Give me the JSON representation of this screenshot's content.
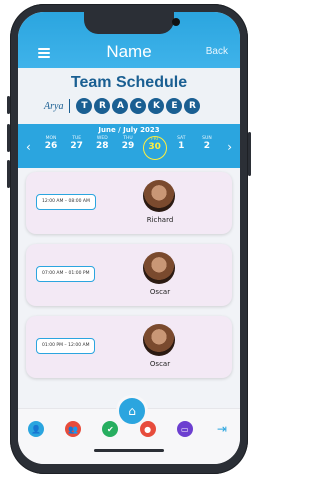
{
  "header": {
    "menu_icon": "hamburger-icon",
    "title": "Name",
    "back_label": "Back"
  },
  "brand": {
    "team_title": "Team Schedule",
    "arya": "Arya",
    "tracker_letters": [
      "T",
      "R",
      "A",
      "C",
      "K",
      "E",
      "R"
    ]
  },
  "calendar": {
    "month": "June / July 2023",
    "days": [
      {
        "dow": "MON",
        "date": "26"
      },
      {
        "dow": "TUE",
        "date": "27"
      },
      {
        "dow": "WED",
        "date": "28"
      },
      {
        "dow": "THU",
        "date": "29"
      },
      {
        "dow": "FRI",
        "date": "30",
        "active": true
      },
      {
        "dow": "SAT",
        "date": "1"
      },
      {
        "dow": "SUN",
        "date": "2"
      }
    ]
  },
  "schedule": [
    {
      "time": "12:00 AM – 08:00 AM",
      "name": "Richard"
    },
    {
      "time": "07:00 AM – 01:00 PM",
      "name": "Oscar"
    },
    {
      "time": "01:00 PM – 12:00 AM",
      "name": "Oscar"
    }
  ],
  "bottom_nav": {
    "icons": [
      "profile-icon",
      "group-icon",
      "person-check-icon",
      "home-icon",
      "pill-icon",
      "bed-icon",
      "logout-icon"
    ]
  },
  "colors": {
    "primary": "#2ba5df",
    "brand_dark": "#1a5f92",
    "card": "#f3e9f5",
    "accent_active": "#ffef3d"
  }
}
